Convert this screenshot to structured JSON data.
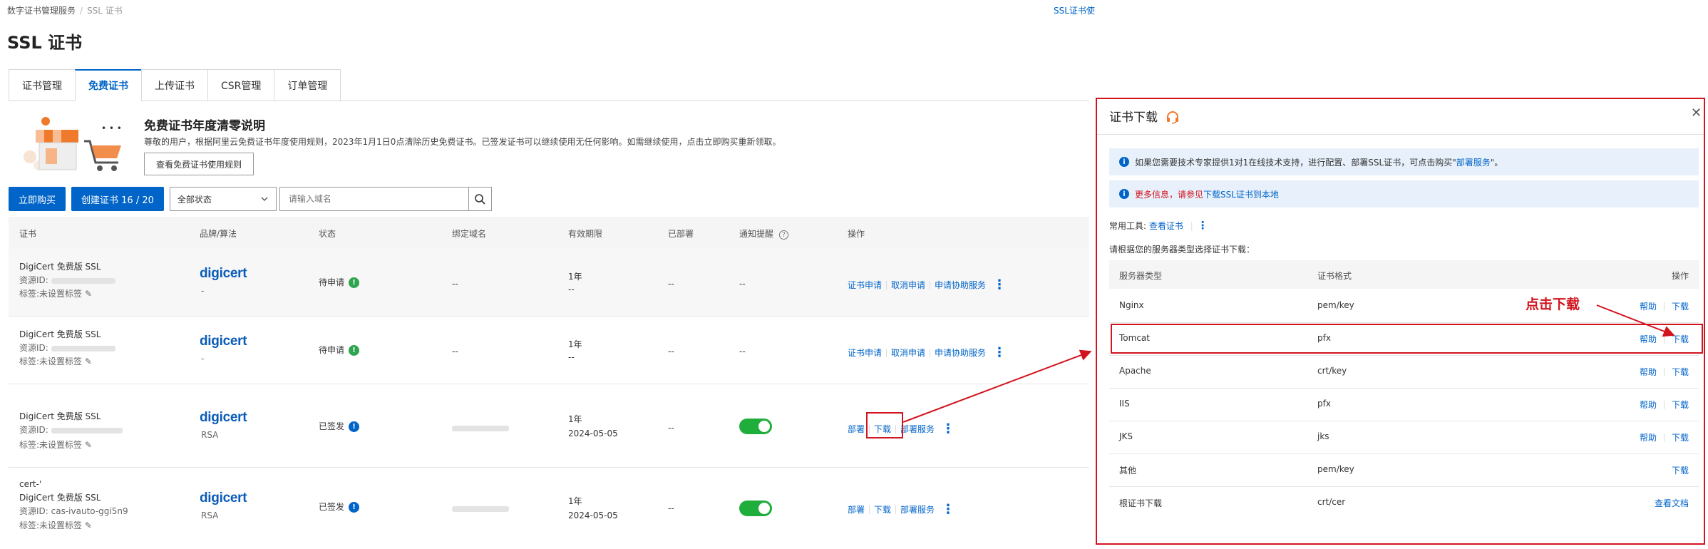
{
  "breadcrumb": {
    "root": "数字证书管理服务",
    "sep": "/",
    "current": "SSL 证书"
  },
  "top_link": "SSL证书使",
  "page_title": "SSL 证书",
  "tabs": [
    "证书管理",
    "免费证书",
    "上传证书",
    "CSR管理",
    "订单管理"
  ],
  "active_tab": "免费证书",
  "promo": {
    "title": "免费证书年度清零说明",
    "desc": "尊敬的用户，根据阿里云免费证书年度使用规则，2023年1月1日0点清除历史免费证书。已签发证书可以继续使用无任何影响。如需继续使用，点击立即购买重新领取。",
    "button": "查看免费证书使用规则"
  },
  "toolbar": {
    "buy": "立即购买",
    "create": "创建证书 16 / 20",
    "status_select": "全部状态",
    "search_placeholder": "请输入域名"
  },
  "columns": [
    "证书",
    "品牌/算法",
    "状态",
    "绑定域名",
    "有效期限",
    "已部署",
    "通知提醒",
    "操作"
  ],
  "rows": [
    {
      "cert_line1": "DigiCert 免费版 SSL",
      "resource": "资源ID:",
      "tag": "标签:未设置标签",
      "brand": "digicert",
      "algo": "-",
      "status": "待申请",
      "domain": "--",
      "validity": "1年",
      "expiry": "--",
      "deployed": "--",
      "notify": "--",
      "ops": [
        "证书申请",
        "取消申请",
        "申请协助服务"
      ]
    },
    {
      "cert_line1": "DigiCert 免费版 SSL",
      "resource": "资源ID:",
      "tag": "标签:未设置标签",
      "brand": "digicert",
      "algo": "-",
      "status": "待申请",
      "domain": "--",
      "validity": "1年",
      "expiry": "--",
      "deployed": "--",
      "notify": "--",
      "ops": [
        "证书申请",
        "取消申请",
        "申请协助服务"
      ]
    },
    {
      "cert_line1": "DigiCert 免费版 SSL",
      "resource": "资源ID:",
      "tag": "标签:未设置标签",
      "brand": "digicert",
      "algo": "RSA",
      "status": "已签发",
      "validity": "1年",
      "expiry": "2024-05-05",
      "deployed": "--",
      "ops": [
        "部署",
        "下载",
        "部署服务"
      ]
    },
    {
      "cert_name": "cert-'",
      "cert_line1": "DigiCert 免费版 SSL",
      "resource": "资源ID: cas-ivauto-ggi5n9",
      "tag": "标签:未设置标签",
      "brand": "digicert",
      "algo": "RSA",
      "status": "已签发",
      "validity": "1年",
      "expiry": "2024-05-05",
      "deployed": "--",
      "ops": [
        "部署",
        "下载",
        "部署服务"
      ]
    }
  ],
  "panel": {
    "title": "证书下载",
    "info1_prefix": "如果您需要技术专家提供1对1在线技术支持，进行配置、部署SSL证书，可点击购买\"",
    "info1_link": "部署服务",
    "info1_suffix": "\"。",
    "info2_red": "更多信息，请参见",
    "info2_link": "下载SSL证书到本地",
    "tools_label": "常用工具:",
    "tools_link": "查看证书",
    "instruction": "请根据您的服务器类型选择证书下载：",
    "headers": [
      "服务器类型",
      "证书格式",
      "操作"
    ],
    "rows": [
      {
        "server": "Nginx",
        "format": "pem/key",
        "help": "帮助",
        "download": "下载"
      },
      {
        "server": "Tomcat",
        "format": "pfx",
        "help": "帮助",
        "download": "下载"
      },
      {
        "server": "Apache",
        "format": "crt/key",
        "help": "帮助",
        "download": "下载"
      },
      {
        "server": "IIS",
        "format": "pfx",
        "help": "帮助",
        "download": "下载"
      },
      {
        "server": "JKS",
        "format": "jks",
        "help": "帮助",
        "download": "下载"
      },
      {
        "server": "其他",
        "format": "pem/key",
        "download": "下载"
      },
      {
        "server": "根证书下载",
        "format": "crt/cer",
        "docs": "查看文档"
      }
    ]
  },
  "annotation": "点击下载",
  "colors": {
    "accent": "#0064c8",
    "highlight": "#d2141e",
    "toggle_on": "#1fae3c"
  }
}
